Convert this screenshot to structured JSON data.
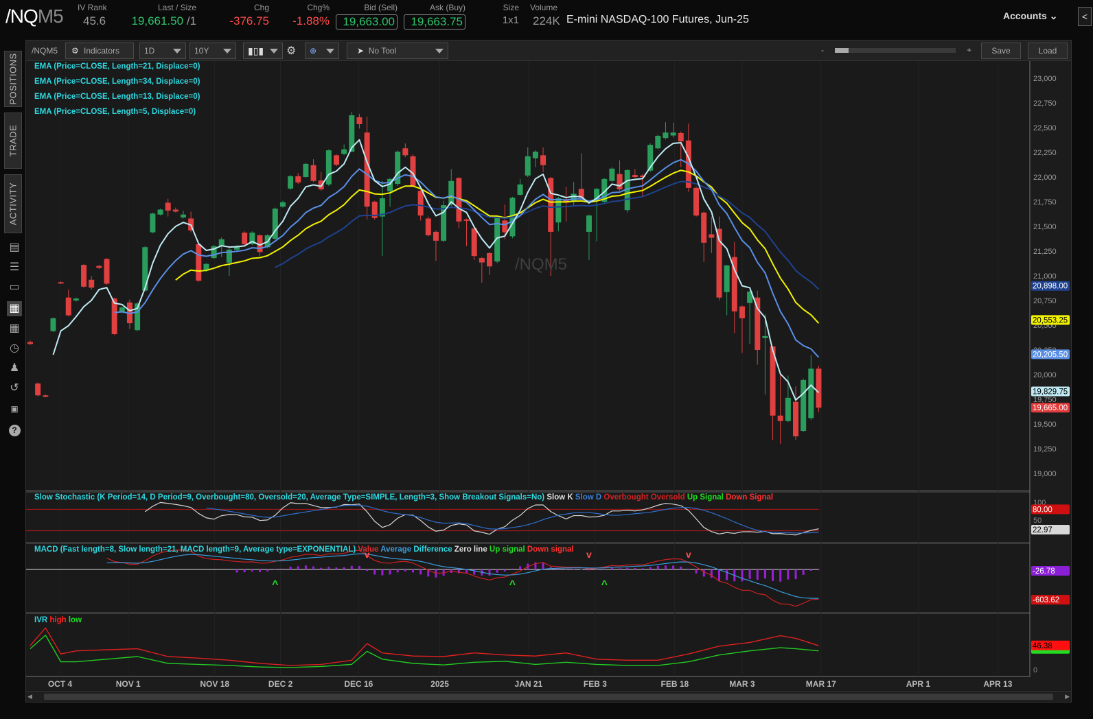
{
  "header": {
    "symbol_main": "/NQ",
    "symbol_suffix": "M5",
    "iv_rank_label": "IV Rank",
    "iv_rank": "45.6",
    "last_label": "Last / Size",
    "last": "19,661.50",
    "last_size": "/1",
    "chg_label": "Chg",
    "chg": "-376.75",
    "chgpct_label": "Chg%",
    "chgpct": "-1.88%",
    "bid_label": "Bid (Sell)",
    "bid": "19,663.00",
    "ask_label": "Ask (Buy)",
    "ask": "19,663.75",
    "size_label": "Size",
    "size": "1x1",
    "volume_label": "Volume",
    "volume": "224K",
    "description": "E-mini NASDAQ-100 Futures, Jun-25",
    "accounts": "Accounts",
    "collapse": "<"
  },
  "sidebar": {
    "tabs": [
      "POSITIONS",
      "TRADE",
      "ACTIVITY"
    ],
    "icons": [
      "news-icon",
      "list-icon",
      "monitor-icon",
      "chart-icon",
      "grid-icon",
      "gauge-icon",
      "people-icon",
      "history-icon",
      "fx-icon",
      "help-icon"
    ]
  },
  "toolbar": {
    "symbol": "/NQM5",
    "indicators": "Indicators",
    "aggregation": "1D",
    "time_range": "10Y",
    "drawing_tool": "No Tool",
    "zoom_minus": "-",
    "zoom_plus": "+",
    "save": "Save",
    "load": "Load"
  },
  "watermark": "/NQM5",
  "studies": {
    "ema": [
      {
        "label": "EMA (Price=CLOSE, Length=21, Displace=0)",
        "length": 21,
        "color": "#f2f200",
        "last": "20,553.25",
        "last_value": 20553.25,
        "text_color": "#000"
      },
      {
        "label": "EMA (Price=CLOSE, Length=34, Displace=0)",
        "length": 34,
        "color": "#1e4290",
        "last": "20,898.00",
        "last_value": 20898,
        "text_color": "#fff"
      },
      {
        "label": "EMA (Price=CLOSE, Length=13, Displace=0)",
        "length": 13,
        "color": "#5a8fe6",
        "last": "20,205.50",
        "last_value": 20205.5,
        "text_color": "#fff"
      },
      {
        "label": "EMA (Price=CLOSE, Length=5, Displace=0)",
        "length": 5,
        "color": "#bfeaf4",
        "last": "19,829.75",
        "last_value": 19829.75,
        "text_color": "#000"
      }
    ],
    "last_price_badge": {
      "text": "19,665.00",
      "value": 19665,
      "color": "#e23b3b"
    },
    "stochastic": {
      "title": "Slow Stochastic (K Period=14, D Period=9, Overbought=80, Oversold=20, Average Type=SIMPLE, Length=3, Show Breakout Signals=No)",
      "legend": [
        {
          "text": "Slow K",
          "color": "#e0e0e0"
        },
        {
          "text": "Slow D",
          "color": "#3a7fd9"
        },
        {
          "text": "Overbought",
          "color": "#d42020"
        },
        {
          "text": "Oversold",
          "color": "#d42020"
        },
        {
          "text": "Up Signal",
          "color": "#22dd22"
        },
        {
          "text": "Down Signal",
          "color": "#ff3030"
        }
      ],
      "k_period": 14,
      "d_period": 9,
      "smooth": 3,
      "overbought": 80,
      "oversold": 20,
      "axis_labels": [
        "100",
        "50"
      ],
      "badge_ob": "80.00",
      "badge_k": "22.97",
      "badge_k_value": 22.97
    },
    "macd": {
      "title": "MACD (Fast length=8, Slow length=21, MACD length=9, Average type=EXPONENTIAL)",
      "legend": [
        {
          "text": "Value",
          "color": "#e03030"
        },
        {
          "text": "Average",
          "color": "#3a9ad9"
        },
        {
          "text": "Difference",
          "color": "#2fd8e0"
        },
        {
          "text": "Zero line",
          "color": "#dddddd"
        },
        {
          "text": "Up signal",
          "color": "#22dd22"
        },
        {
          "text": "Down signal",
          "color": "#ff3030"
        }
      ],
      "fast": 8,
      "slow": 21,
      "signal": 9,
      "badge_diff": "-26.78",
      "badge_diff_value": -26.78,
      "badge_value": "-603.62",
      "badge_value_value": -603.62,
      "up_signal_index": [
        32,
        63,
        75
      ],
      "down_signal_index": [
        44,
        73,
        86
      ]
    },
    "ivr": {
      "title": "IVR",
      "legend": [
        {
          "text": "high",
          "color": "#ff2020"
        },
        {
          "text": "low",
          "color": "#22dd22"
        }
      ],
      "badge_high": "46.38",
      "badge_high_value": 46.38,
      "axis_zero": "0"
    }
  },
  "chart_data": {
    "type": "candlestick",
    "symbol": "/NQM5",
    "aggregation": "1D",
    "y_ticks": [
      "23,000",
      "22,750",
      "22,500",
      "22,250",
      "22,000",
      "21,750",
      "21,500",
      "21,250",
      "21,000",
      "20,750",
      "20,500",
      "20,250",
      "20,000",
      "19,750",
      "19,500",
      "19,250",
      "19,000"
    ],
    "ylim": [
      19000,
      23000
    ],
    "x_ticks": [
      {
        "label": "OCT 4",
        "index": 3.9
      },
      {
        "label": "NOV 1",
        "index": 12.8
      },
      {
        "label": "NOV 18",
        "index": 24.1
      },
      {
        "label": "DEC 2",
        "index": 32.7
      },
      {
        "label": "DEC 16",
        "index": 42.9
      },
      {
        "label": "2025",
        "index": 53.5
      },
      {
        "label": "JAN 21",
        "index": 65.1
      },
      {
        "label": "FEB 3",
        "index": 73.8
      },
      {
        "label": "FEB 18",
        "index": 84.2
      },
      {
        "label": "MAR 3",
        "index": 93.0
      },
      {
        "label": "MAR 17",
        "index": 103.3
      },
      {
        "label": "APR 1",
        "index": 116.0
      },
      {
        "label": "APR 13",
        "index": 126.4
      }
    ],
    "ohlc": [
      [
        20330,
        20345,
        20300,
        20310
      ],
      [
        19910,
        19920,
        19780,
        19790
      ],
      [
        19790,
        19800,
        19770,
        19775
      ],
      [
        20440,
        20580,
        20430,
        20570
      ],
      [
        20935,
        20945,
        20920,
        20925
      ],
      [
        20780,
        20860,
        20590,
        20600
      ],
      [
        20750,
        20780,
        20740,
        20770
      ],
      [
        21110,
        21120,
        20880,
        20890
      ],
      [
        20960,
        21000,
        20860,
        20880
      ],
      [
        21100,
        21110,
        21070,
        21080
      ],
      [
        21170,
        21180,
        20910,
        20920
      ],
      [
        20770,
        20780,
        20400,
        20410
      ],
      [
        20630,
        20690,
        20620,
        20680
      ],
      [
        20730,
        20760,
        20460,
        20520
      ],
      [
        20450,
        20730,
        20440,
        20720
      ],
      [
        20850,
        21300,
        20840,
        21290
      ],
      [
        21440,
        21640,
        21430,
        21630
      ],
      [
        21620,
        21680,
        21610,
        21670
      ],
      [
        21740,
        21780,
        21600,
        21660
      ],
      [
        21670,
        21690,
        21640,
        21650
      ],
      [
        21590,
        21660,
        21580,
        21620
      ],
      [
        21580,
        21650,
        21440,
        21460
      ],
      [
        21320,
        21330,
        20940,
        20950
      ],
      [
        21060,
        21130,
        21040,
        21120
      ],
      [
        21180,
        21310,
        21170,
        21300
      ],
      [
        21300,
        21390,
        21190,
        21370
      ],
      [
        21133,
        21280,
        21000,
        21265
      ],
      [
        21265,
        21310,
        21250,
        21300
      ],
      [
        21437,
        21450,
        21310,
        21320
      ],
      [
        21320,
        21450,
        21310,
        21437
      ],
      [
        21410,
        21420,
        21200,
        21240
      ],
      [
        21290,
        21420,
        21280,
        21410
      ],
      [
        21375,
        21690,
        21360,
        21680
      ],
      [
        21700,
        21760,
        21690,
        21744
      ],
      [
        21883,
        22020,
        21870,
        22008
      ],
      [
        22008,
        22040,
        21930,
        21945
      ],
      [
        22000,
        22140,
        21990,
        22133
      ],
      [
        22120,
        22180,
        21950,
        21960
      ],
      [
        21965,
        22050,
        21860,
        21875
      ],
      [
        21925,
        22280,
        21910,
        22270
      ],
      [
        22220,
        22230,
        22110,
        22125
      ],
      [
        22235,
        22330,
        22220,
        22280
      ],
      [
        22257,
        22660,
        22250,
        22625
      ],
      [
        22605,
        22640,
        22490,
        22535
      ],
      [
        22450,
        22610,
        21570,
        21700
      ],
      [
        21750,
        21760,
        21570,
        21585
      ],
      [
        21600,
        21960,
        21200,
        21785
      ],
      [
        21855,
        21990,
        21700,
        21980
      ],
      [
        21930,
        22270,
        21910,
        22257
      ],
      [
        22290,
        22340,
        22200,
        22220
      ],
      [
        22210,
        22230,
        21900,
        21910
      ],
      [
        21860,
        21870,
        21560,
        21610
      ],
      [
        21580,
        21600,
        21400,
        21410
      ],
      [
        21445,
        21460,
        21150,
        21355
      ],
      [
        21355,
        21760,
        21340,
        21715
      ],
      [
        21720,
        22080,
        21700,
        21960
      ],
      [
        21990,
        22000,
        21480,
        21550
      ],
      [
        21570,
        21580,
        21300,
        21560
      ],
      [
        21480,
        21490,
        21160,
        21200
      ],
      [
        21180,
        21190,
        20930,
        21135
      ],
      [
        21230,
        21240,
        21010,
        21095
      ],
      [
        21145,
        21600,
        21130,
        21585
      ],
      [
        21560,
        21720,
        21370,
        21440
      ],
      [
        21400,
        21800,
        21380,
        21790
      ],
      [
        21820,
        21980,
        21810,
        21925
      ],
      [
        22015,
        22300,
        22000,
        22210
      ],
      [
        22190,
        22270,
        22100,
        22257
      ],
      [
        22220,
        22300,
        22050,
        22120
      ],
      [
        21990,
        22000,
        21000,
        21445
      ],
      [
        21540,
        21800,
        21450,
        21785
      ],
      [
        21770,
        21900,
        21550,
        21740
      ],
      [
        21750,
        21950,
        21700,
        21830
      ],
      [
        21880,
        22240,
        21780,
        21790
      ],
      [
        21445,
        21620,
        21160,
        21610
      ],
      [
        21770,
        21890,
        21350,
        21880
      ],
      [
        21750,
        21990,
        21740,
        21980
      ],
      [
        21960,
        22100,
        21950,
        22085
      ],
      [
        22030,
        22170,
        21860,
        21875
      ],
      [
        21665,
        22080,
        21640,
        22070
      ],
      [
        22020,
        22080,
        21990,
        22000
      ],
      [
        22015,
        22030,
        21800,
        22000
      ],
      [
        22065,
        22340,
        22050,
        22325
      ],
      [
        22290,
        22430,
        22280,
        22417
      ],
      [
        22395,
        22555,
        22380,
        22450
      ],
      [
        22420,
        22550,
        22400,
        22450
      ],
      [
        22445,
        22460,
        22100,
        22360
      ],
      [
        22370,
        22540,
        21850,
        21890
      ],
      [
        21890,
        21900,
        21600,
        21610
      ],
      [
        21640,
        21650,
        21140,
        21335
      ],
      [
        21420,
        21600,
        21230,
        21385
      ],
      [
        21475,
        21600,
        20750,
        20780
      ],
      [
        20835,
        21110,
        20600,
        21105
      ],
      [
        21190,
        21340,
        20420,
        20640
      ],
      [
        20690,
        20700,
        20220,
        20570
      ],
      [
        20725,
        20850,
        20310,
        20840
      ],
      [
        20780,
        20850,
        20100,
        20250
      ],
      [
        20370,
        20610,
        19800,
        20390
      ],
      [
        20285,
        20290,
        19340,
        19585
      ],
      [
        19585,
        20010,
        19300,
        19530
      ],
      [
        19530,
        19990,
        19520,
        19765
      ],
      [
        19725,
        19880,
        19340,
        19375
      ],
      [
        19430,
        19960,
        19420,
        19945
      ],
      [
        19560,
        20200,
        19540,
        20060
      ],
      [
        20060,
        20090,
        19620,
        19665
      ]
    ],
    "ivr_index": [
      0,
      2,
      4,
      6,
      10,
      14,
      18,
      22,
      26,
      30,
      34,
      38,
      42,
      44,
      46,
      50,
      54,
      58,
      62,
      66,
      70,
      74,
      78,
      82,
      86,
      90,
      94,
      98,
      100,
      103
    ],
    "ivr_high": [
      46,
      80,
      30,
      36,
      38,
      40,
      25,
      22,
      18,
      12,
      8,
      10,
      18,
      50,
      32,
      26,
      25,
      32,
      28,
      26,
      32,
      20,
      18,
      18,
      30,
      45,
      52,
      65,
      60,
      46
    ],
    "ivr_low": [
      40,
      66,
      15,
      15,
      20,
      25,
      12,
      10,
      8,
      5,
      4,
      6,
      10,
      35,
      20,
      12,
      9,
      14,
      16,
      10,
      14,
      10,
      8,
      8,
      15,
      28,
      36,
      42,
      40,
      36
    ]
  }
}
